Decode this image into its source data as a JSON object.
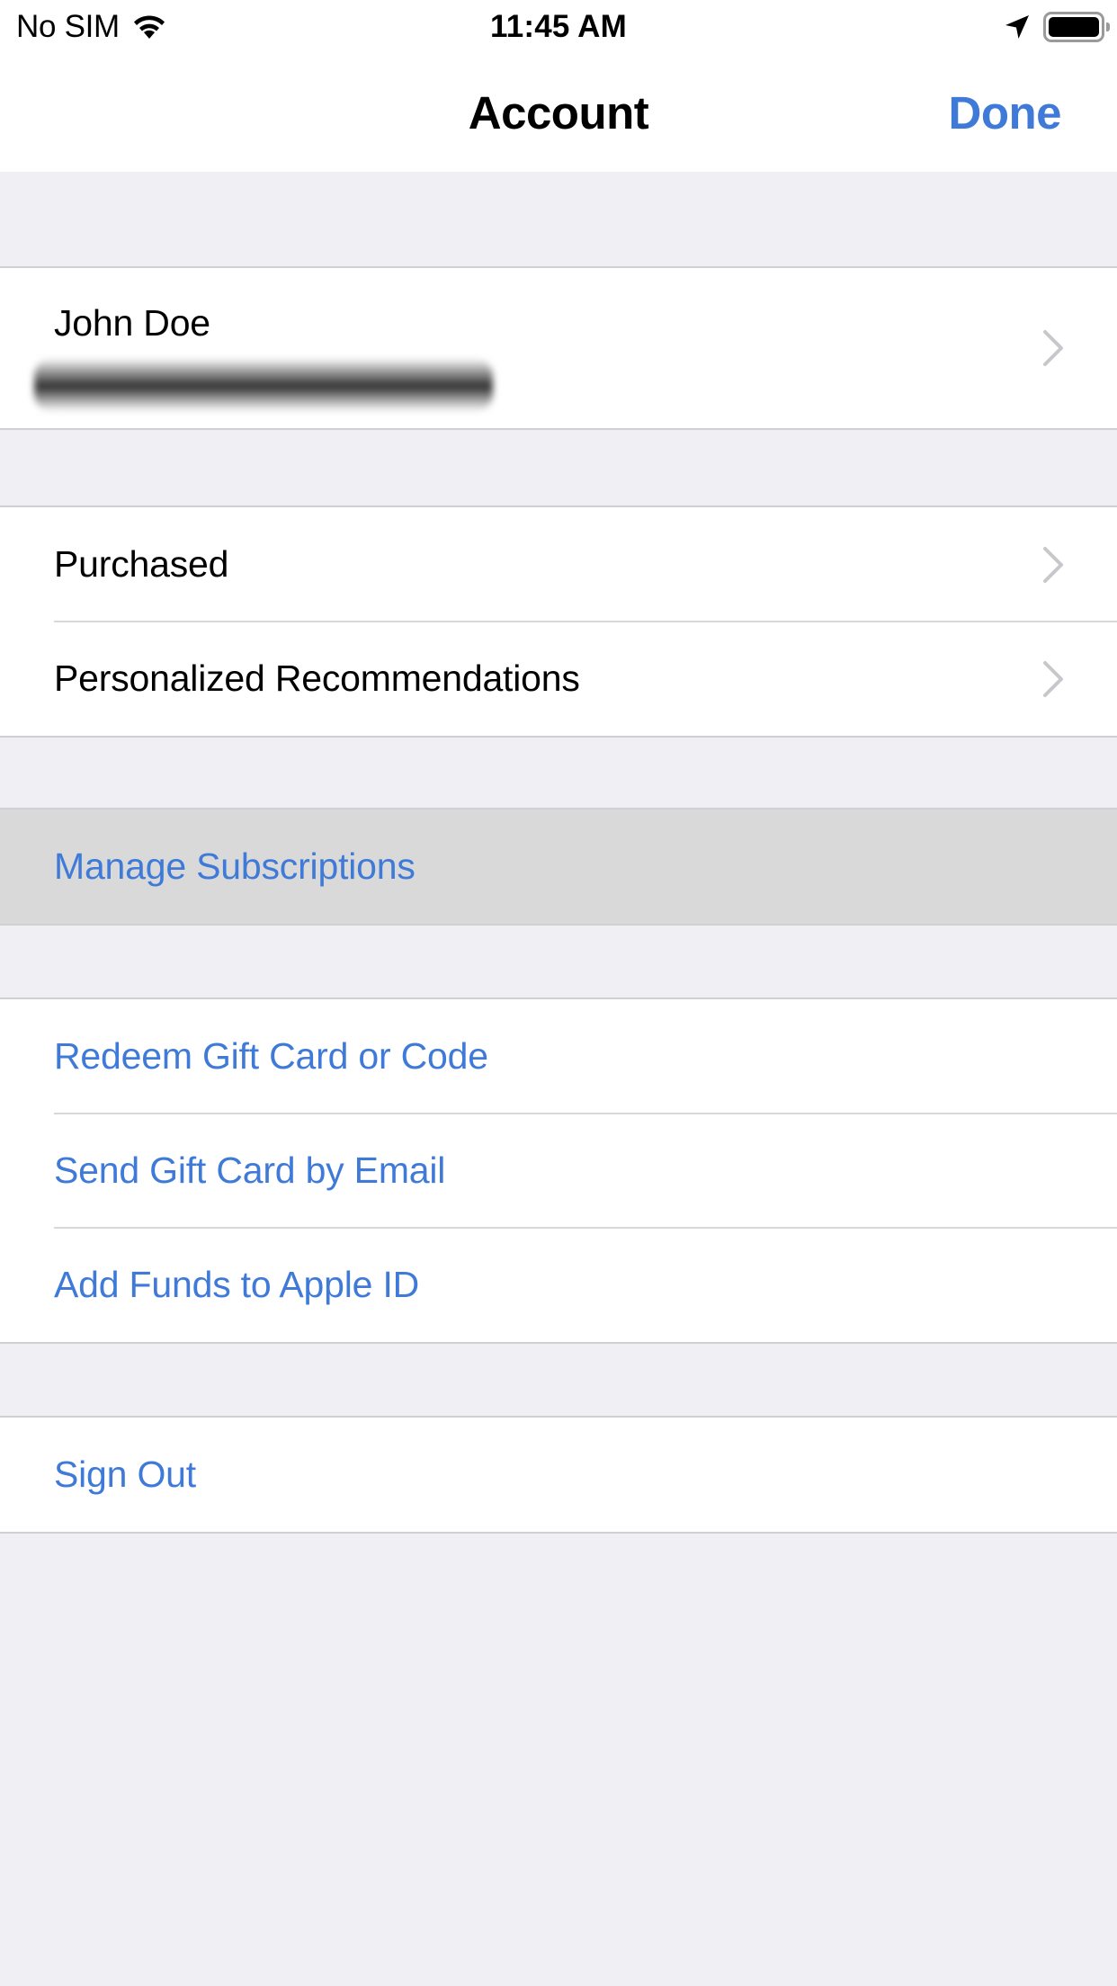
{
  "status_bar": {
    "carrier": "No SIM",
    "time": "11:45 AM",
    "icons": [
      "wifi-icon",
      "location-arrow-icon",
      "battery-icon"
    ],
    "battery_level": 1.0
  },
  "nav": {
    "title": "Account",
    "done_label": "Done"
  },
  "colors": {
    "accent": "#3f7ad8",
    "background": "#efeff4",
    "cell": "#ffffff",
    "highlight": "#d9d9d9",
    "separator": "#d8d8dc",
    "chevron": "#c7c7cc"
  },
  "profile": {
    "name": "John Doe",
    "email_redacted": true
  },
  "sections": {
    "library": [
      {
        "label": "Purchased",
        "has_chevron": true
      },
      {
        "label": "Personalized Recommendations",
        "has_chevron": true
      }
    ],
    "subscriptions": [
      {
        "label": "Manage Subscriptions",
        "highlighted": true
      }
    ],
    "gift_cards": [
      {
        "label": "Redeem Gift Card or Code"
      },
      {
        "label": "Send Gift Card by Email"
      },
      {
        "label": "Add Funds to Apple ID"
      }
    ],
    "session": [
      {
        "label": "Sign Out"
      }
    ]
  }
}
